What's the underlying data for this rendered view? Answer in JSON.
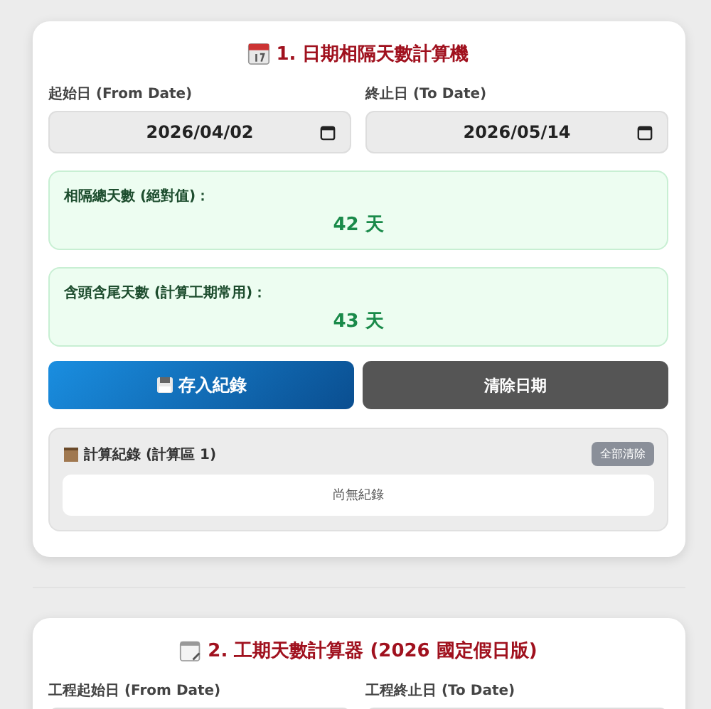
{
  "sections": [
    {
      "title": "1. 日期相隔天數計算機",
      "fields": [
        {
          "label": "起始日 (From Date)",
          "value": "2026/04/02"
        },
        {
          "label": "終止日 (To Date)",
          "value": "2026/05/14"
        }
      ],
      "results": [
        {
          "label": "相隔總天數 (絕對值)：",
          "value": "42 天"
        },
        {
          "label": "含頭含尾天數 (計算工期常用)：",
          "value": "43 天"
        }
      ],
      "buttons": [
        {
          "kind": "primary",
          "label": "存入紀錄"
        },
        {
          "kind": "secondary",
          "label": "清除日期"
        }
      ],
      "records": {
        "title": "計算紀錄 (計算區 1)",
        "clear_button": "全部清除",
        "empty_text": "尚無紀錄"
      }
    },
    {
      "title": "2. 工期天數計算器 (2026 國定假日版)",
      "fields": [
        {
          "label": "工程起始日 (From Date)"
        },
        {
          "label": "工程終止日 (To Date)"
        }
      ]
    }
  ]
}
